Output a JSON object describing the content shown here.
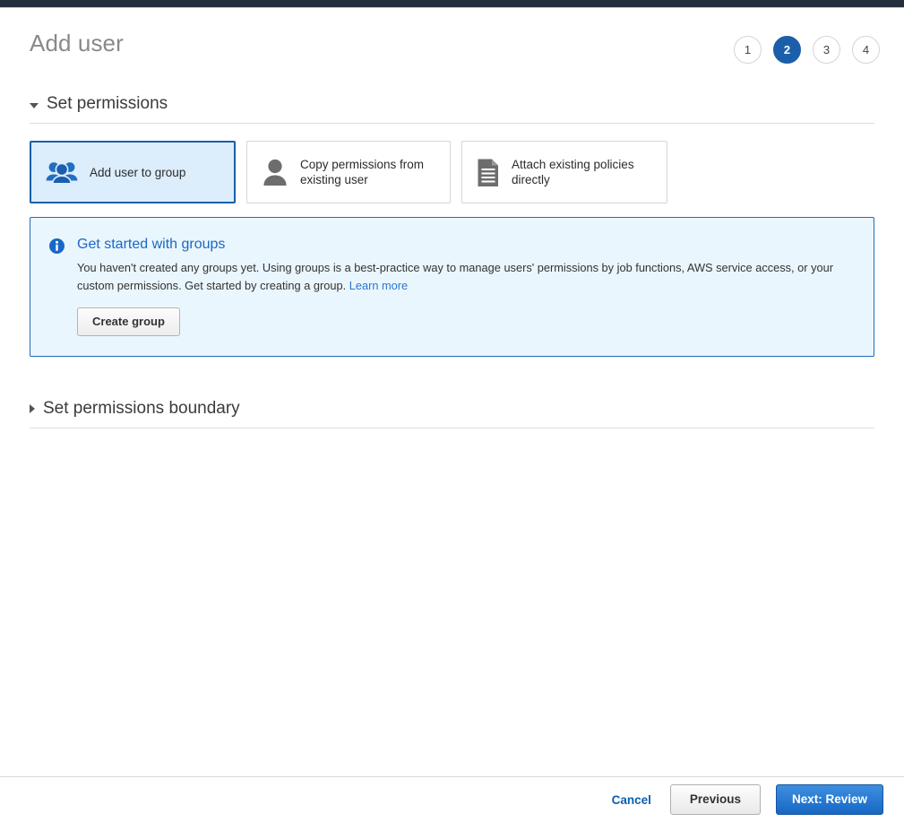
{
  "header": {
    "title": "Add user",
    "steps": [
      {
        "label": "1",
        "active": false
      },
      {
        "label": "2",
        "active": true
      },
      {
        "label": "3",
        "active": false
      },
      {
        "label": "4",
        "active": false
      }
    ]
  },
  "permissions_section": {
    "title": "Set permissions",
    "expanded": true,
    "options": [
      {
        "label": "Add user to group",
        "icon": "group-users-icon",
        "selected": true
      },
      {
        "label": "Copy permissions from existing user",
        "icon": "single-user-icon",
        "selected": false
      },
      {
        "label": "Attach existing policies directly",
        "icon": "document-icon",
        "selected": false
      }
    ]
  },
  "alert": {
    "icon": "info-icon",
    "title": "Get started with groups",
    "text": "You haven't created any groups yet. Using groups is a best-practice way to manage users' permissions by job functions, AWS service access, or your custom permissions. Get started by creating a group.",
    "link_label": "Learn more",
    "button_label": "Create group"
  },
  "boundary_section": {
    "title": "Set permissions boundary",
    "expanded": false
  },
  "footer": {
    "cancel_label": "Cancel",
    "previous_label": "Previous",
    "next_label": "Next: Review"
  },
  "colors": {
    "topbar": "#232f3e",
    "accent_blue": "#1b5faa",
    "link_blue": "#2a76d2",
    "alert_bg": "#eaf6fd",
    "selected_card_bg": "#dcedfb",
    "next_button": "#1667c4"
  }
}
